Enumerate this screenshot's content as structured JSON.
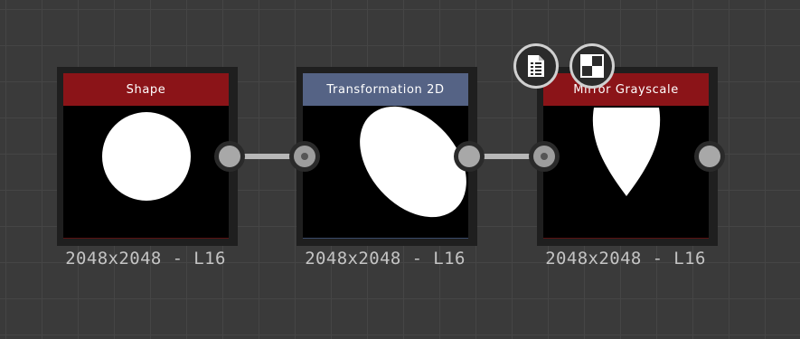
{
  "nodes": [
    {
      "title": "Shape",
      "header_color": "#8b1418",
      "caption": "2048x2048 - L16"
    },
    {
      "title": "Transformation 2D",
      "header_color": "#556385",
      "caption": "2048x2048 - L16"
    },
    {
      "title": "Mirror Grayscale",
      "header_color": "#8b1418",
      "caption": "2048x2048 - L16"
    }
  ],
  "floating_buttons": [
    {
      "icon": "document-icon"
    },
    {
      "icon": "checker-icon"
    }
  ],
  "colors": {
    "canvas_bg": "#3a3a3a",
    "grid_line": "#454545",
    "node_frame": "#1f1f1f",
    "link": "#b8b8b8",
    "caption_text": "#c4c4c4"
  }
}
